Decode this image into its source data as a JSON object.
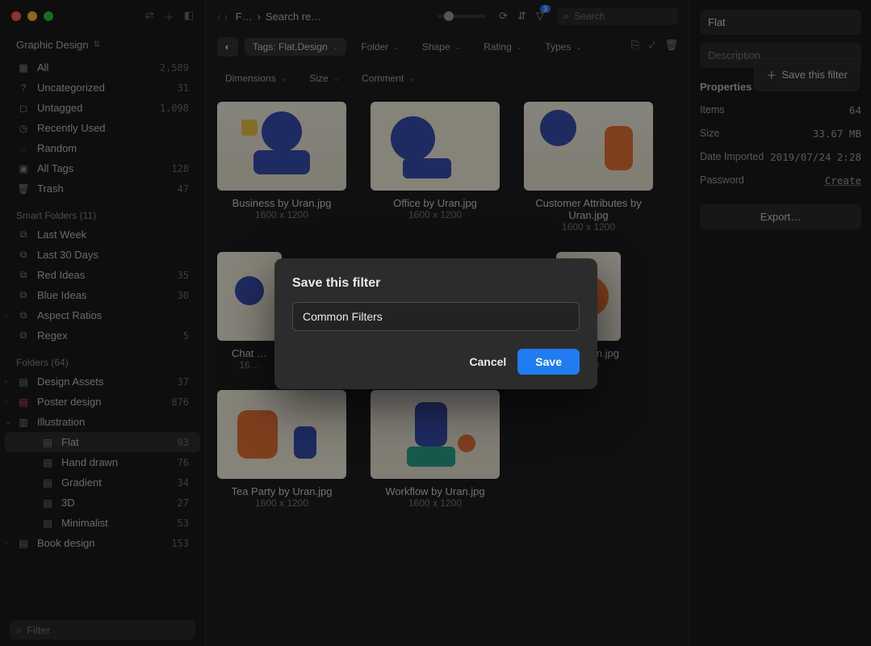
{
  "library": {
    "name": "Graphic Design"
  },
  "sidebar": {
    "all": {
      "label": "All",
      "count": "2,589"
    },
    "uncategorized": {
      "label": "Uncategorized",
      "count": "31"
    },
    "untagged": {
      "label": "Untagged",
      "count": "1,098"
    },
    "recent": {
      "label": "Recently Used"
    },
    "random": {
      "label": "Random"
    },
    "alltags": {
      "label": "All Tags",
      "count": "128"
    },
    "trash": {
      "label": "Trash",
      "count": "47"
    },
    "smart_header": "Smart Folders (11)",
    "smart": [
      {
        "label": "Last Week"
      },
      {
        "label": "Last 30 Days"
      },
      {
        "label": "Red Ideas",
        "count": "35"
      },
      {
        "label": "Blue Ideas",
        "count": "30"
      },
      {
        "label": "Aspect Ratios"
      },
      {
        "label": "Regex",
        "count": "5"
      }
    ],
    "folders_header": "Folders (64)",
    "folders": [
      {
        "label": "Design Assets",
        "count": "37",
        "color": "grey"
      },
      {
        "label": "Poster design",
        "count": "876",
        "color": "red"
      },
      {
        "label": "Illustration",
        "color": "fld",
        "open": true,
        "children": [
          {
            "label": "Flat",
            "count": "93",
            "active": true
          },
          {
            "label": "Hand drawn",
            "count": "76"
          },
          {
            "label": "Gradient",
            "count": "34"
          },
          {
            "label": "3D",
            "count": "27"
          },
          {
            "label": "Minimalist",
            "count": "53"
          }
        ]
      },
      {
        "label": "Book design",
        "count": "153",
        "color": "fld"
      }
    ],
    "filter_placeholder": "Filter"
  },
  "topbar": {
    "crumb1": "F…",
    "crumb2": "Search re…",
    "filter_badge": "3",
    "search_placeholder": "Search"
  },
  "filterbar": {
    "tags_pill": "Tags: Flat,Design",
    "folder": "Folder",
    "shape": "Shape",
    "rating": "Rating",
    "types": "Types",
    "dimensions": "Dimensions",
    "size": "Size",
    "comment": "Comment",
    "save_filter_popover": "Save this filter"
  },
  "grid": {
    "items": [
      {
        "name": "Business by Uran.jpg",
        "dim": "1600 x 1200"
      },
      {
        "name": "Office by Uran.jpg",
        "dim": "1600 x 1200"
      },
      {
        "name": "Customer Attributes by Uran.jpg",
        "dim": "1600 x 1200"
      },
      {
        "name": "Chat …",
        "dim": "16…"
      },
      {
        "name": "… y Uran.jpg",
        "dim": "1200"
      },
      {
        "name": "Tea Party by Uran.jpg",
        "dim": "1600 x 1200"
      },
      {
        "name": "Workflow by Uran.jpg",
        "dim": "1600 x 1200"
      }
    ]
  },
  "panel": {
    "name_value": "Flat",
    "desc_placeholder": "Description",
    "properties_header": "Properties",
    "items_label": "Items",
    "items_value": "64",
    "size_label": "Size",
    "size_value": "33.67 MB",
    "date_label": "Date Imported",
    "date_value": "2019/07/24 2:28",
    "pass_label": "Password",
    "pass_value": "Create",
    "export_label": "Export…"
  },
  "modal": {
    "title": "Save this filter",
    "input_value": "Common Filters",
    "cancel": "Cancel",
    "save": "Save"
  }
}
